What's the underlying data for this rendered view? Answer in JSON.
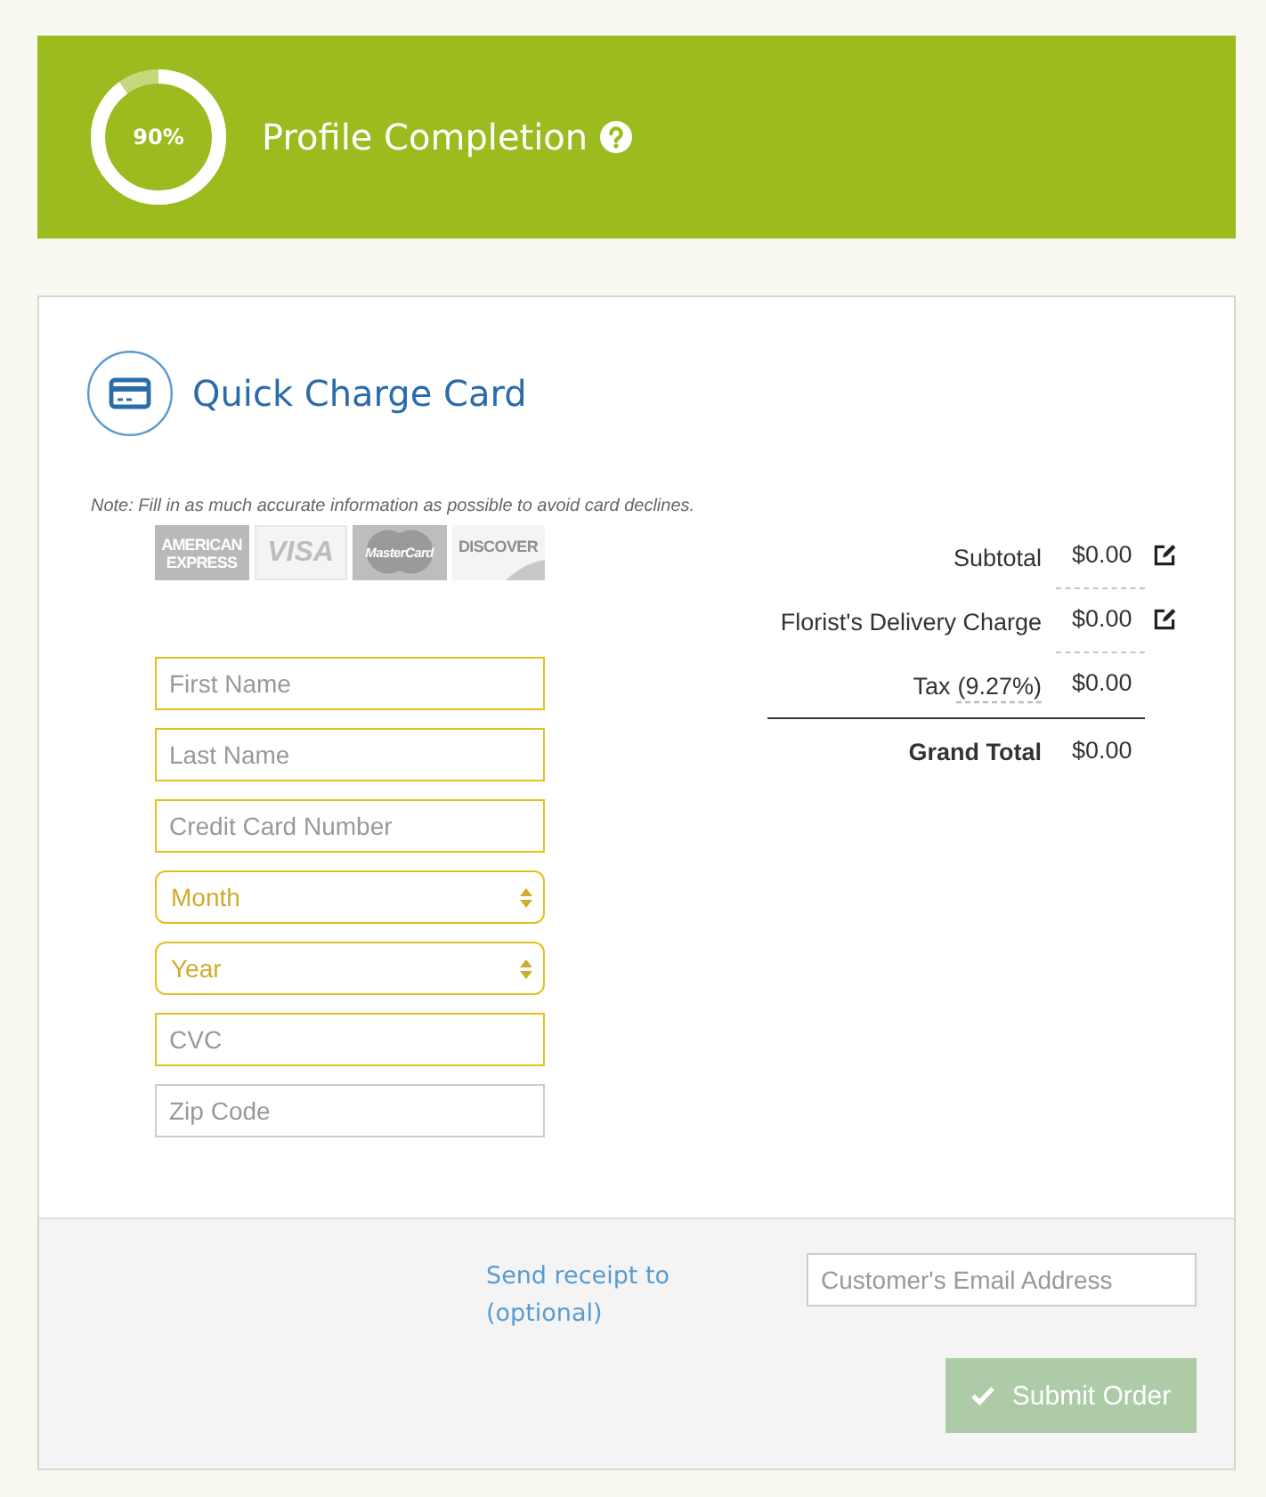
{
  "header": {
    "progress": {
      "level": 0.9,
      "label": "90%"
    },
    "title": "Profile Completion"
  },
  "card": {
    "title": "Quick Charge Card",
    "note": "Note: Fill in as much accurate information as possible to avoid card declines.",
    "card_logos": [
      {
        "kind": "amex",
        "text": "AMERICAN EXPRESS"
      },
      {
        "kind": "visa",
        "text": "VISA"
      },
      {
        "kind": "mastercard",
        "text": "MasterCard"
      },
      {
        "kind": "discover",
        "text": "DISCOVER"
      }
    ],
    "fields": [
      {
        "kind": "text",
        "placeholder": "First Name",
        "highlighted": true
      },
      {
        "kind": "text",
        "placeholder": "Last Name",
        "highlighted": true
      },
      {
        "kind": "text",
        "placeholder": "Credit Card Number",
        "highlighted": true
      },
      {
        "kind": "select",
        "value": "Month",
        "highlighted": true
      },
      {
        "kind": "select",
        "value": "Year",
        "highlighted": true
      },
      {
        "kind": "text",
        "placeholder": "CVC",
        "highlighted": true
      },
      {
        "kind": "text",
        "placeholder": "Zip Code",
        "highlighted": false
      }
    ],
    "summary": [
      {
        "kind": "item",
        "label": "Subtotal",
        "amount": "$0.00",
        "editable": true
      },
      {
        "kind": "item",
        "label": "Florist's Delivery Charge",
        "amount": "$0.00",
        "editable": true
      },
      {
        "kind": "tax",
        "label": "Tax",
        "rate": "(9.27%)",
        "amount": "$0.00",
        "editable": false
      },
      {
        "kind": "total",
        "label": "Grand Total",
        "amount": "$0.00",
        "editable": false
      }
    ]
  },
  "footer": {
    "receipt_label": "Send receipt to (optional)",
    "email": {
      "placeholder": "Customer's Email Address"
    },
    "submit": {
      "label": "Submit Order",
      "disabled": true
    }
  }
}
